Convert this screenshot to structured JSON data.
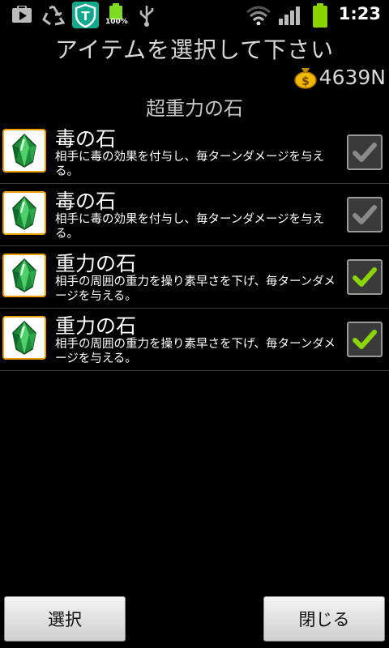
{
  "status_bar": {
    "time": "1:23",
    "battery_percent_label": "100%",
    "icons": [
      "play-store-icon",
      "recycle-icon",
      "security-shield-icon",
      "battery-icon",
      "usb-icon",
      "wifi-icon",
      "signal-icon",
      "battery-full-icon"
    ]
  },
  "title": "アイテムを選択して下さい",
  "money": "4639N",
  "subtitle": "超重力の石",
  "items": [
    {
      "name": "毒の石",
      "description": "相手に毒の効果を付与し、毎ターンダメージを与える。",
      "checked": false
    },
    {
      "name": "毒の石",
      "description": "相手に毒の効果を付与し、毎ターンダメージを与える。",
      "checked": false
    },
    {
      "name": "重力の石",
      "description": "相手の周囲の重力を操り素早さを下げ、毎ターンダメージを与える。",
      "checked": true
    },
    {
      "name": "重力の石",
      "description": "相手の周囲の重力を操り素早さを下げ、毎ターンダメージを与える。",
      "checked": true
    }
  ],
  "buttons": {
    "select": "選択",
    "close": "閉じる"
  },
  "colors": {
    "check_on": "#8bd400",
    "check_off": "#8a8a8a",
    "icon_border": "#e8a000"
  }
}
